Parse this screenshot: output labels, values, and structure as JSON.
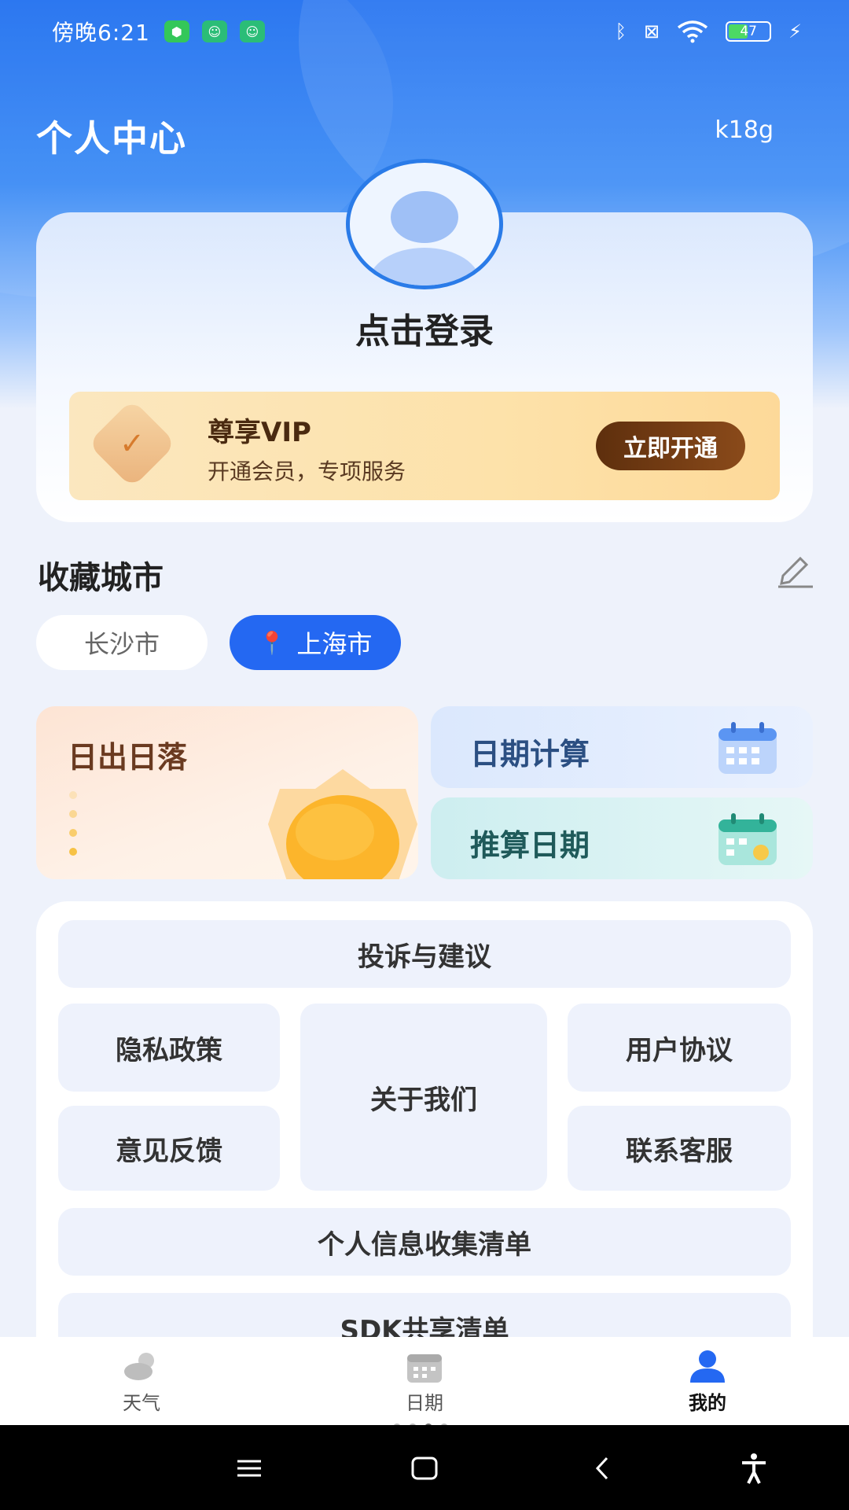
{
  "status_bar": {
    "time": "傍晚6:21",
    "battery": "47",
    "icons": [
      "shield-icon",
      "cat-icon",
      "cat-icon",
      "bluetooth-icon",
      "sim-icon",
      "wifi-icon",
      "battery-icon",
      "charging-icon"
    ]
  },
  "header": {
    "title": "个人中心",
    "version": "k18g"
  },
  "profile": {
    "login_label": "点击登录"
  },
  "vip": {
    "title": "尊享VIP",
    "subtitle": "开通会员，专项服务",
    "button_label": "立即开通"
  },
  "favorites": {
    "title": "收藏城市",
    "cities": [
      {
        "name": "长沙市",
        "active": false
      },
      {
        "name": "上海市",
        "active": true
      }
    ]
  },
  "tools": {
    "sunrise": "日出日落",
    "date_calc": "日期计算",
    "date_infer": "推算日期"
  },
  "links": {
    "complaint": "投诉与建议",
    "privacy": "隐私政策",
    "about": "关于我们",
    "terms": "用户协议",
    "feedback": "意见反馈",
    "support": "联系客服",
    "info_list": "个人信息收集清单",
    "sdk_list": "SDK共享清单"
  },
  "bottom_nav": {
    "items": [
      {
        "label": "天气",
        "icon": "weather-icon",
        "active": false
      },
      {
        "label": "日期",
        "icon": "calendar-icon",
        "active": false
      },
      {
        "label": "我的",
        "icon": "user-icon",
        "active": true
      }
    ]
  },
  "colors": {
    "primary": "#2468f2",
    "vip_button": "#6b3612"
  }
}
